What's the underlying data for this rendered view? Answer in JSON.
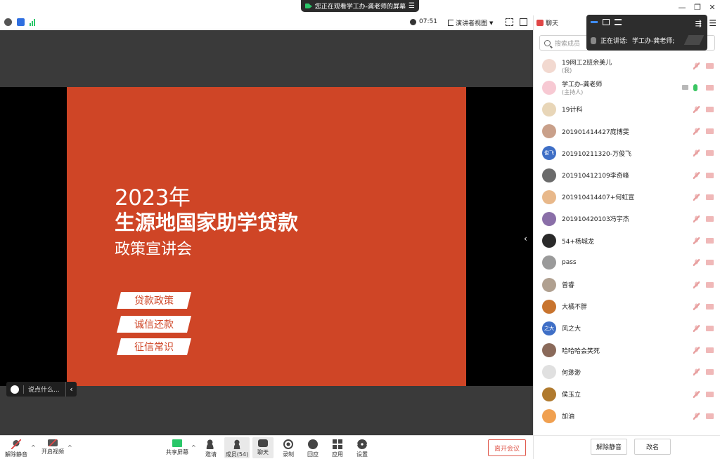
{
  "window": {
    "viewing_banner": "您正在观看学工办-龚老师的屏幕",
    "controls": [
      "—",
      "❐",
      "✕"
    ]
  },
  "meeting_bar": {
    "timer": "07:51",
    "view_mode": "演讲者视图"
  },
  "slide": {
    "year": "2023年",
    "title": "生源地国家助学贷款",
    "subtitle": "政策宣讲会",
    "tags": [
      "贷款政策",
      "诚信还款",
      "征信常识"
    ]
  },
  "chat_input": {
    "placeholder": "说点什么..."
  },
  "toolbar": {
    "unmute": "解除静音",
    "start_video": "开启视频",
    "share_screen": "共享屏幕",
    "invite": "邀请",
    "members": "成员(54)",
    "chat": "聊天",
    "record": "录制",
    "reaction": "回应",
    "apps": "应用",
    "settings": "设置",
    "leave": "离开会议"
  },
  "panel": {
    "tab": "聊天",
    "search_placeholder": "搜索成员",
    "speaking_label": "正在讲话:",
    "speaking_name": "学工办-龚老师;",
    "footer_unmute": "解除静音",
    "footer_rename": "改名",
    "members": [
      {
        "name": "19网工2班余美儿",
        "role": "(我)",
        "avatar_color": "#f2d9d0",
        "avatar_text": ""
      },
      {
        "name": "学工办-龚老师",
        "role": "(主持人)",
        "avatar_color": "#f7c9d3",
        "avatar_text": "",
        "host": true
      },
      {
        "name": "19计科",
        "role": "",
        "avatar_color": "#e8d6b8",
        "avatar_text": ""
      },
      {
        "name": "201901414427庞博雯",
        "role": "",
        "avatar_color": "#c9a08a",
        "avatar_text": ""
      },
      {
        "name": "201910211320-万俊飞",
        "role": "",
        "avatar_color": "#3f6fc6",
        "avatar_text": "俊飞"
      },
      {
        "name": "201910412109李奇峰",
        "role": "",
        "avatar_color": "#6b6b6b",
        "avatar_text": ""
      },
      {
        "name": "201910414407+何虹宣",
        "role": "",
        "avatar_color": "#e8b88a",
        "avatar_text": ""
      },
      {
        "name": "201910420103冯宇杰",
        "role": "",
        "avatar_color": "#8a6fa8",
        "avatar_text": ""
      },
      {
        "name": "54+杨城龙",
        "role": "",
        "avatar_color": "#2a2a2a",
        "avatar_text": ""
      },
      {
        "name": "pass",
        "role": "",
        "avatar_color": "#9a9a9a",
        "avatar_text": ""
      },
      {
        "name": "曾睿",
        "role": "",
        "avatar_color": "#b0a090",
        "avatar_text": ""
      },
      {
        "name": "大橘不胖",
        "role": "",
        "avatar_color": "#c8742e",
        "avatar_text": ""
      },
      {
        "name": "风之大",
        "role": "",
        "avatar_color": "#3f6fc6",
        "avatar_text": "之大"
      },
      {
        "name": "哈哈哈会笑死",
        "role": "",
        "avatar_color": "#8a6a5a",
        "avatar_text": ""
      },
      {
        "name": "何渺渺",
        "role": "",
        "avatar_color": "#e0e0e0",
        "avatar_text": ""
      },
      {
        "name": "侯玉立",
        "role": "",
        "avatar_color": "#b07a2e",
        "avatar_text": ""
      },
      {
        "name": "加油",
        "role": "",
        "avatar_color": "#f0a050",
        "avatar_text": ""
      }
    ]
  },
  "colors": {
    "slide_bg": "#cf4526",
    "stage_bg": "#3a3a3a",
    "leave": "#e05a4e",
    "mic_on": "#3ac562"
  }
}
